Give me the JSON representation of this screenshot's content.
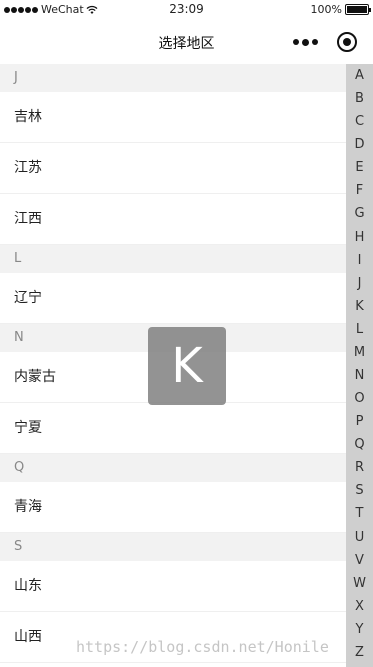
{
  "status_bar": {
    "carrier": "WeChat",
    "time": "23:09",
    "battery_text": "100%",
    "battery_level": 1.0
  },
  "nav": {
    "title": "选择地区"
  },
  "groups": [
    {
      "letter": "J",
      "items": [
        "吉林",
        "江苏",
        "江西"
      ]
    },
    {
      "letter": "L",
      "items": [
        "辽宁"
      ]
    },
    {
      "letter": "N",
      "items": [
        "内蒙古",
        "宁夏"
      ]
    },
    {
      "letter": "Q",
      "items": [
        "青海"
      ]
    },
    {
      "letter": "S",
      "items": [
        "山东",
        "山西"
      ]
    }
  ],
  "index_letters": [
    "A",
    "B",
    "C",
    "D",
    "E",
    "F",
    "G",
    "H",
    "I",
    "J",
    "K",
    "L",
    "M",
    "N",
    "O",
    "P",
    "Q",
    "R",
    "S",
    "T",
    "U",
    "V",
    "W",
    "X",
    "Y",
    "Z"
  ],
  "overlay_letter": "K",
  "watermark": "https://blog.csdn.net/Honile",
  "colors": {
    "group_header_bg": "#f2f2f2",
    "index_bar_bg": "#cfcfcf",
    "overlay_bg": "#808080"
  }
}
